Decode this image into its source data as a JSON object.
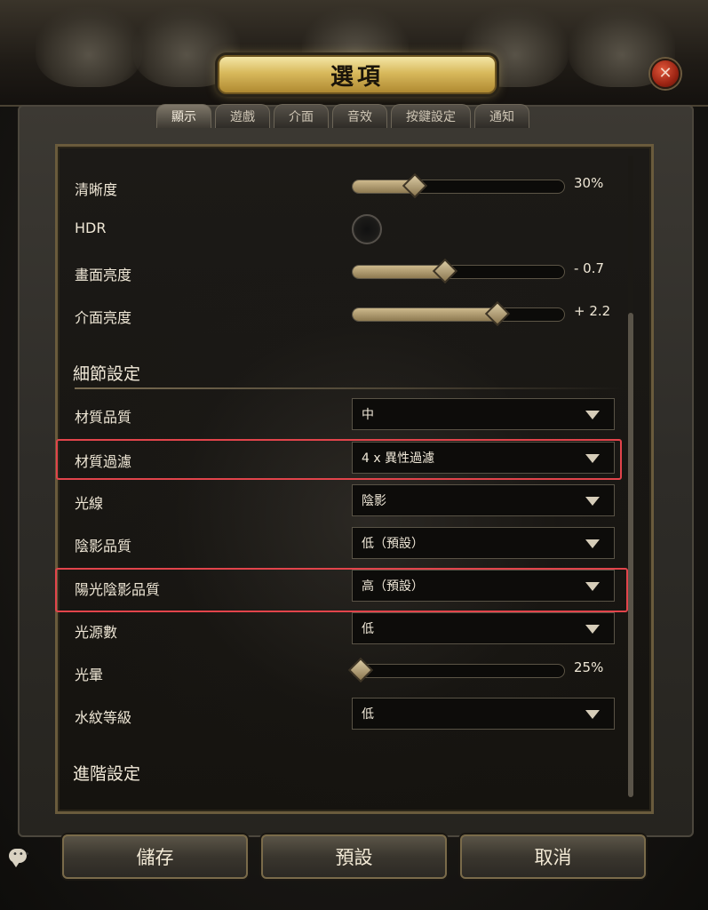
{
  "window": {
    "title": "選項",
    "close_icon": "close-icon"
  },
  "tabs": [
    {
      "label": "顯示",
      "active": true
    },
    {
      "label": "遊戲",
      "active": false
    },
    {
      "label": "介面",
      "active": false
    },
    {
      "label": "音效",
      "active": false
    },
    {
      "label": "按鍵設定",
      "active": false
    },
    {
      "label": "通知",
      "active": false
    }
  ],
  "settings": {
    "sharpness": {
      "label": "清晰度",
      "value_text": "30%",
      "fraction": 0.3
    },
    "hdr": {
      "label": "HDR",
      "enabled": false
    },
    "brightness": {
      "label": "畫面亮度",
      "value_text": "- 0.7",
      "fraction": 0.44
    },
    "ui_brightness": {
      "label": "介面亮度",
      "value_text": "+ 2.2",
      "fraction": 0.69
    },
    "detail_section": "細節設定",
    "texture_quality": {
      "label": "材質品質",
      "value": "中"
    },
    "texture_filtering": {
      "label": "材質過濾",
      "value": "4 x 異性過濾"
    },
    "lighting": {
      "label": "光線",
      "value": "陰影"
    },
    "shadow_quality": {
      "label": "陰影品質",
      "value": "低（預設）"
    },
    "sun_shadow_quality": {
      "label": "陽光陰影品質",
      "value": "高（預設）"
    },
    "light_sources": {
      "label": "光源數",
      "value": "低"
    },
    "bloom": {
      "label": "光暈",
      "value_text": "25%",
      "fraction": 0.04
    },
    "water_detail": {
      "label": "水紋等級",
      "value": "低"
    },
    "advanced_section": "進階設定"
  },
  "buttons": {
    "save": "儲存",
    "default": "預設",
    "cancel": "取消"
  },
  "colors": {
    "highlight": "#e2444b",
    "accent_gold": "#d8b95c"
  }
}
